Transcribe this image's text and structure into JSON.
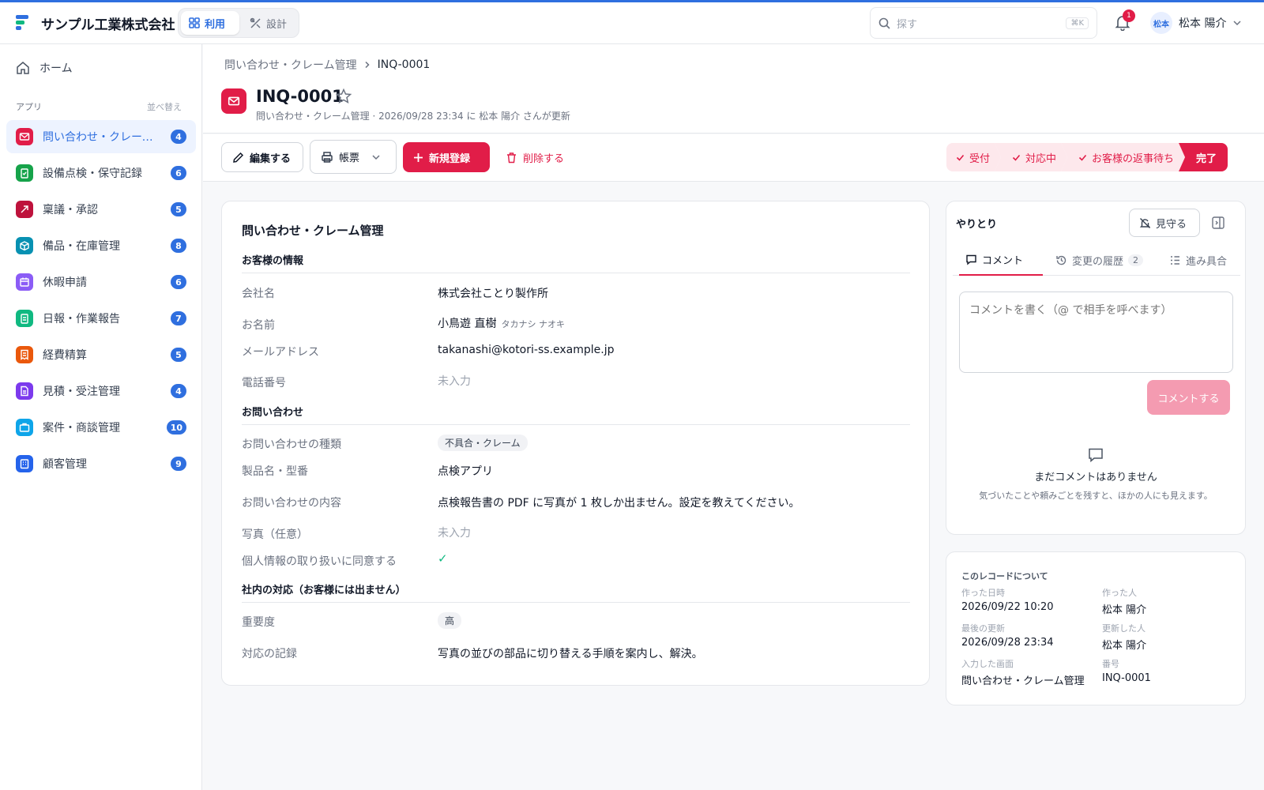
{
  "header": {
    "company": "サンプル工業株式会社",
    "mode_use": "利用",
    "mode_design": "設計",
    "search_placeholder": "探す",
    "search_shortcut": "⌘K",
    "notification_count": "1",
    "user_avatar": "松本",
    "user_name": "松本 陽介"
  },
  "sidebar": {
    "home": "ホーム",
    "section_label": "アプリ",
    "sort_label": "並べ替え",
    "apps": [
      {
        "label": "問い合わせ・クレーム管理",
        "count": "4",
        "color": "#e11d48"
      },
      {
        "label": "設備点検・保守記録",
        "count": "6",
        "color": "#16a34a"
      },
      {
        "label": "稟議・承認",
        "count": "5",
        "color": "#be123c"
      },
      {
        "label": "備品・在庫管理",
        "count": "8",
        "color": "#0891b2"
      },
      {
        "label": "休暇申請",
        "count": "6",
        "color": "#8b5cf6"
      },
      {
        "label": "日報・作業報告",
        "count": "7",
        "color": "#10b981"
      },
      {
        "label": "経費精算",
        "count": "5",
        "color": "#ea580c"
      },
      {
        "label": "見積・受注管理",
        "count": "4",
        "color": "#7c3aed"
      },
      {
        "label": "案件・商談管理",
        "count": "10",
        "color": "#0ea5e9"
      },
      {
        "label": "顧客管理",
        "count": "9",
        "color": "#2563eb"
      }
    ]
  },
  "page": {
    "breadcrumb_parent": "問い合わせ・クレーム管理",
    "breadcrumb_current": "INQ-0001",
    "record_title": "INQ-0001",
    "record_meta": "問い合わせ・クレーム管理 · 2026/09/28 23:34 に 松本 陽介 さんが更新"
  },
  "toolbar": {
    "edit": "編集する",
    "print": "帳票",
    "new": "新規登録",
    "delete": "削除する",
    "steps": [
      "受付",
      "対応中",
      "お客様の返事待ち",
      "完了"
    ]
  },
  "form": {
    "title": "問い合わせ・クレーム管理",
    "sections": {
      "customer": "お客様の情報",
      "inquiry": "お問い合わせ",
      "internal": "社内の対応（お客様には出ません）"
    },
    "fields": {
      "company_label": "会社名",
      "company_value": "株式会社ことり製作所",
      "name_label": "お名前",
      "name_value": "小鳥遊 直樹",
      "name_kana": "タカナシ ナオキ",
      "email_label": "メールアドレス",
      "email_value": "takanashi@kotori-ss.example.jp",
      "phone_label": "電話番号",
      "phone_value": "未入力",
      "type_label": "お問い合わせの種類",
      "type_value": "不具合・クレーム",
      "product_label": "製品名・型番",
      "product_value": "点検アプリ",
      "content_label": "お問い合わせの内容",
      "content_value": "点検報告書の PDF に写真が 1 枚しか出ません。設定を教えてください。",
      "photo_label": "写真（任意）",
      "photo_value": "未入力",
      "consent_label": "個人情報の取り扱いに同意する",
      "consent_value": "✓",
      "priority_label": "重要度",
      "priority_value": "高",
      "log_label": "対応の記録",
      "log_value": "写真の並びの部品に切り替える手順を案内し、解決。"
    }
  },
  "activity": {
    "title": "やりとり",
    "watch": "見守る",
    "tab_comment": "コメント",
    "tab_history": "変更の履歴",
    "tab_history_count": "2",
    "tab_progress": "進み具合",
    "comment_placeholder": "コメントを書く（@ で相手を呼べます）",
    "comment_button": "コメントする",
    "empty_title": "まだコメントはありません",
    "empty_sub": "気づいたことや頼みごとを残すと、ほかの人にも見えます。"
  },
  "record_info": {
    "title": "このレコードについて",
    "created_label": "作った日時",
    "created_value": "2026/09/22 10:20",
    "creator_label": "作った人",
    "creator_value": "松本 陽介",
    "updated_label": "最後の更新",
    "updated_value": "2026/09/28 23:34",
    "updater_label": "更新した人",
    "updater_value": "松本 陽介",
    "screen_label": "入力した画面",
    "screen_value": "問い合わせ・クレーム管理",
    "number_label": "番号",
    "number_value": "INQ-0001"
  },
  "colors": {
    "accent_blue": "#2f6fdf",
    "accent_red": "#e11d48"
  }
}
